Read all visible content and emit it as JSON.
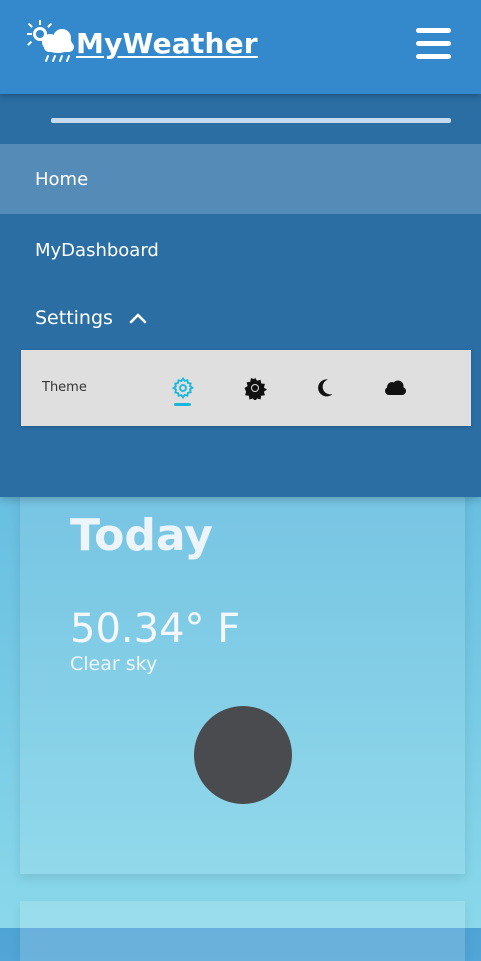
{
  "header": {
    "brand": "MyWeather",
    "brand_icon": "weather-logo-icon",
    "menu_icon": "hamburger-icon"
  },
  "drawer": {
    "items": [
      {
        "label": "Home",
        "active": true
      },
      {
        "label": "MyDashboard",
        "active": false
      },
      {
        "label": "Settings",
        "expanded": true
      }
    ],
    "theme": {
      "label": "Theme",
      "options": [
        {
          "icon": "auto-theme-gear-icon",
          "selected": true
        },
        {
          "icon": "sun-icon",
          "selected": false
        },
        {
          "icon": "moon-icon",
          "selected": false
        },
        {
          "icon": "cloud-icon",
          "selected": false
        }
      ],
      "selected_color": "#17b8dc"
    }
  },
  "card": {
    "title": "Today",
    "temperature": "50.34° F",
    "description": "Clear sky",
    "weather_icon": "weather-condition-icon"
  },
  "colors": {
    "header": "#3389cb",
    "drawer": "#2b6ea4",
    "active_item": "#558cb7"
  }
}
